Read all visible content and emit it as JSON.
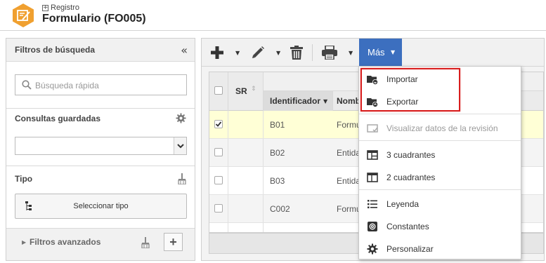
{
  "header": {
    "breadcrumb": "Registro",
    "title": "Formulario (FO005)"
  },
  "filters": {
    "title": "Filtros de búsqueda",
    "quick_search_placeholder": "Búsqueda rápida",
    "saved_queries_label": "Consultas guardadas",
    "saved_queries_value": "",
    "type_label": "Tipo",
    "select_type_button": "Seleccionar tipo",
    "advanced_filters_label": "Filtros avanzados"
  },
  "toolbar": {
    "more_button": "Más",
    "icons": [
      "add-icon",
      "edit-pencil-icon",
      "delete-trash-icon",
      "print-icon"
    ]
  },
  "grid": {
    "columns": [
      "SR",
      "Identificador",
      "Nomb"
    ],
    "rows": [
      {
        "id": "B01",
        "name": "Formu",
        "checked": true
      },
      {
        "id": "B02",
        "name": "Entida",
        "checked": false
      },
      {
        "id": "B03",
        "name": "Entida",
        "checked": false
      },
      {
        "id": "C002",
        "name": "Formu",
        "checked": false
      }
    ]
  },
  "menu": {
    "import": "Importar",
    "export": "Exportar",
    "view_revision": "Visualizar datos de la revisión",
    "quad3": "3 cuadrantes",
    "quad2": "2 cuadrantes",
    "legend": "Leyenda",
    "constants": "Constantes",
    "customize": "Personalizar"
  },
  "colors": {
    "accent": "#3c6fbf",
    "app_badge": "#f0a030",
    "highlight": "#d81e1e",
    "selected_row": "#ffffd6"
  }
}
